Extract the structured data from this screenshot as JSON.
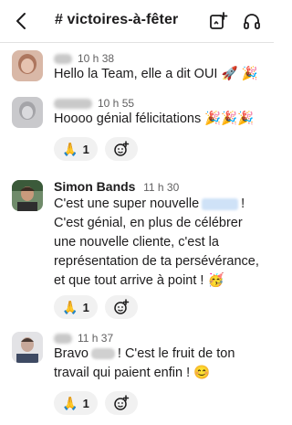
{
  "header": {
    "title": "# victoires-à-fêter"
  },
  "messages": [
    {
      "time": "10 h 38",
      "text": "Hello la Team, elle a dit OUI 🚀 🎉"
    },
    {
      "time": "10 h 55",
      "text": "Hoooo génial félicitations 🎉🎉🎉",
      "reaction": {
        "emoji": "🙏",
        "count": "1"
      }
    },
    {
      "name": "Simon Bands",
      "time": "11 h 30",
      "text_before": "C'est une super nouvelle",
      "text_after": "! C'est génial, en plus de célébrer une nouvelle cliente, c'est la représentation de ta persévérance, et que tout arrive à point ! 🥳",
      "reaction": {
        "emoji": "🙏",
        "count": "1"
      }
    },
    {
      "time": "11 h 37",
      "text_before": "Bravo",
      "text_after": "! C'est le fruit de ton travail qui paient enfin ! 😊",
      "reaction": {
        "emoji": "🙏",
        "count": "1"
      }
    }
  ],
  "icons": {
    "back": "chevron-left-icon",
    "compose": "new-canvas-icon",
    "headphones": "headphones-icon",
    "add_reaction": "add-reaction-icon"
  }
}
